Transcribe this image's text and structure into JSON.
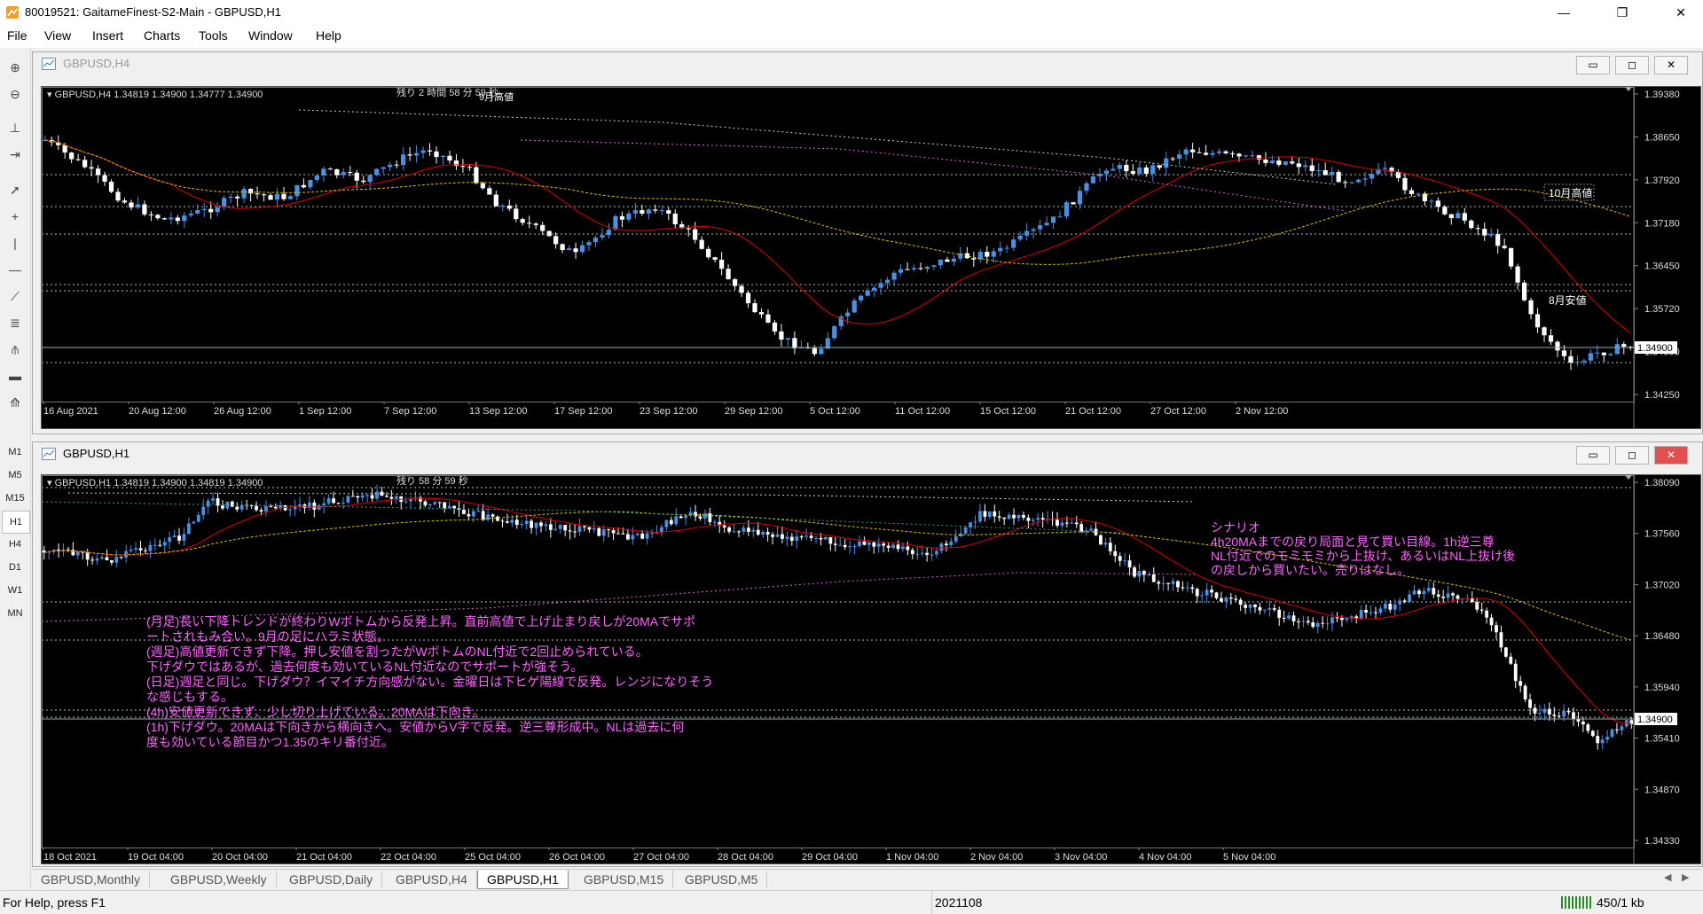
{
  "window": {
    "title": "80019521: GaitameFinest-S2-Main - GBPUSD,H1",
    "minimize": "—",
    "restore": "❐",
    "close": "✕"
  },
  "menu": [
    "File",
    "View",
    "Insert",
    "Charts",
    "Tools",
    "Window",
    "Help"
  ],
  "toolbar": {
    "tools": [
      "zoom-in-icon",
      "zoom-out-icon",
      "period-sep-icon",
      "chart-shift-icon",
      "cursor-icon",
      "crosshair-icon",
      "vertical-line-icon",
      "horizontal-line-icon",
      "trendline-icon",
      "fibo-icon",
      "pitchfork-icon",
      "rectangle-icon",
      "objects-icon"
    ],
    "timeframes": [
      "M1",
      "M5",
      "M15",
      "H1",
      "H4",
      "D1",
      "W1",
      "MN"
    ],
    "active_timeframe": "H1"
  },
  "chart_h4": {
    "window_title": "GBPUSD,H4",
    "info": "GBPUSD,H4 1.34819 1.34900 1.34777 1.34900",
    "countdown": "残り 2 時間 58 分 59 秒",
    "label_top": "9月高値",
    "label_oct_high": "10月高値",
    "label_aug_low": "8月安値",
    "price_labels": [
      "1.39380",
      "1.38650",
      "1.37920",
      "1.37180",
      "1.36450",
      "1.35720",
      "1.34990",
      "1.34250"
    ],
    "current_price": "1.34900",
    "time_labels": [
      "16 Aug 2021",
      "20 Aug 12:00",
      "26 Aug 12:00",
      "1 Sep 12:00",
      "7 Sep 12:00",
      "13 Sep 12:00",
      "17 Sep 12:00",
      "23 Sep 12:00",
      "29 Sep 12:00",
      "5 Oct 12:00",
      "11 Oct 12:00",
      "15 Oct 12:00",
      "21 Oct 12:00",
      "27 Oct 12:00",
      "2 Nov 12:00"
    ]
  },
  "chart_h1": {
    "window_title": "GBPUSD,H1",
    "info": "GBPUSD,H1 1.34819 1.34900 1.34819 1.34900",
    "countdown": "残り 58 分 59 秒",
    "price_labels": [
      "1.38090",
      "1.37560",
      "1.37020",
      "1.36480",
      "1.35940",
      "1.35410",
      "1.34870",
      "1.34330"
    ],
    "current_price": "1.34900",
    "time_labels": [
      "18 Oct 2021",
      "19 Oct 04:00",
      "20 Oct 04:00",
      "21 Oct 04:00",
      "22 Oct 04:00",
      "25 Oct 04:00",
      "26 Oct 04:00",
      "27 Oct 04:00",
      "28 Oct 04:00",
      "29 Oct 04:00",
      "1 Nov 04:00",
      "2 Nov 04:00",
      "3 Nov 04:00",
      "4 Nov 04:00",
      "5 Nov 04:00"
    ],
    "scenario": [
      "シナリオ",
      "4h20MAまでの戻り局面と見て買い目線。1h逆三尊",
      "NL付近でのモミモミから上抜け、あるいはNL上抜け後",
      "の戻しから買いたい。売りはなし。"
    ],
    "analysis": [
      "(月足)長い下降トレンドが終わりWボトムから反発上昇。直前高値で上げ止まり戻しが20MAでサポ",
      "ートされもみ合い。9月の足にハラミ状態。",
      "(週足)高値更新できず下降。押し安値を割ったがWボトムのNL付近で2回止められている。",
      "下げダウではあるが、過去何度も効いているNL付近なのでサポートが強そう。",
      "(日足)週足と同じ。下げダウ？イマイチ方向感がない。金曜日は下ヒゲ陽線で反発。レンジになりそう",
      "な感じもする。",
      "(4h)安値更新できず、少し切り上げている。20MAは下向き。",
      "(1h)下げダウ。20MAは下向きから横向きへ。安値からV字で反発。逆三尊形成中。NLは過去に何",
      "度も効いている節目かつ1.35のキリ番付近。"
    ]
  },
  "tabs": [
    "GBPUSD,Monthly",
    "GBPUSD,Weekly",
    "GBPUSD,Daily",
    "GBPUSD,H4",
    "GBPUSD,H1",
    "GBPUSD,M15",
    "GBPUSD,M5"
  ],
  "active_tab": "GBPUSD,H1",
  "status": {
    "help": "For Help, press F1",
    "profile": "2021108",
    "traffic": "450/1 kb"
  },
  "colors": {
    "bull": "#4a90e2",
    "bear": "#ffffff",
    "ma_red": "#e00000",
    "ma_yellow": "#d4c400",
    "ma_pink": "#d070d0",
    "ma_teal": "#2aa098",
    "note": "#ff66ff"
  }
}
